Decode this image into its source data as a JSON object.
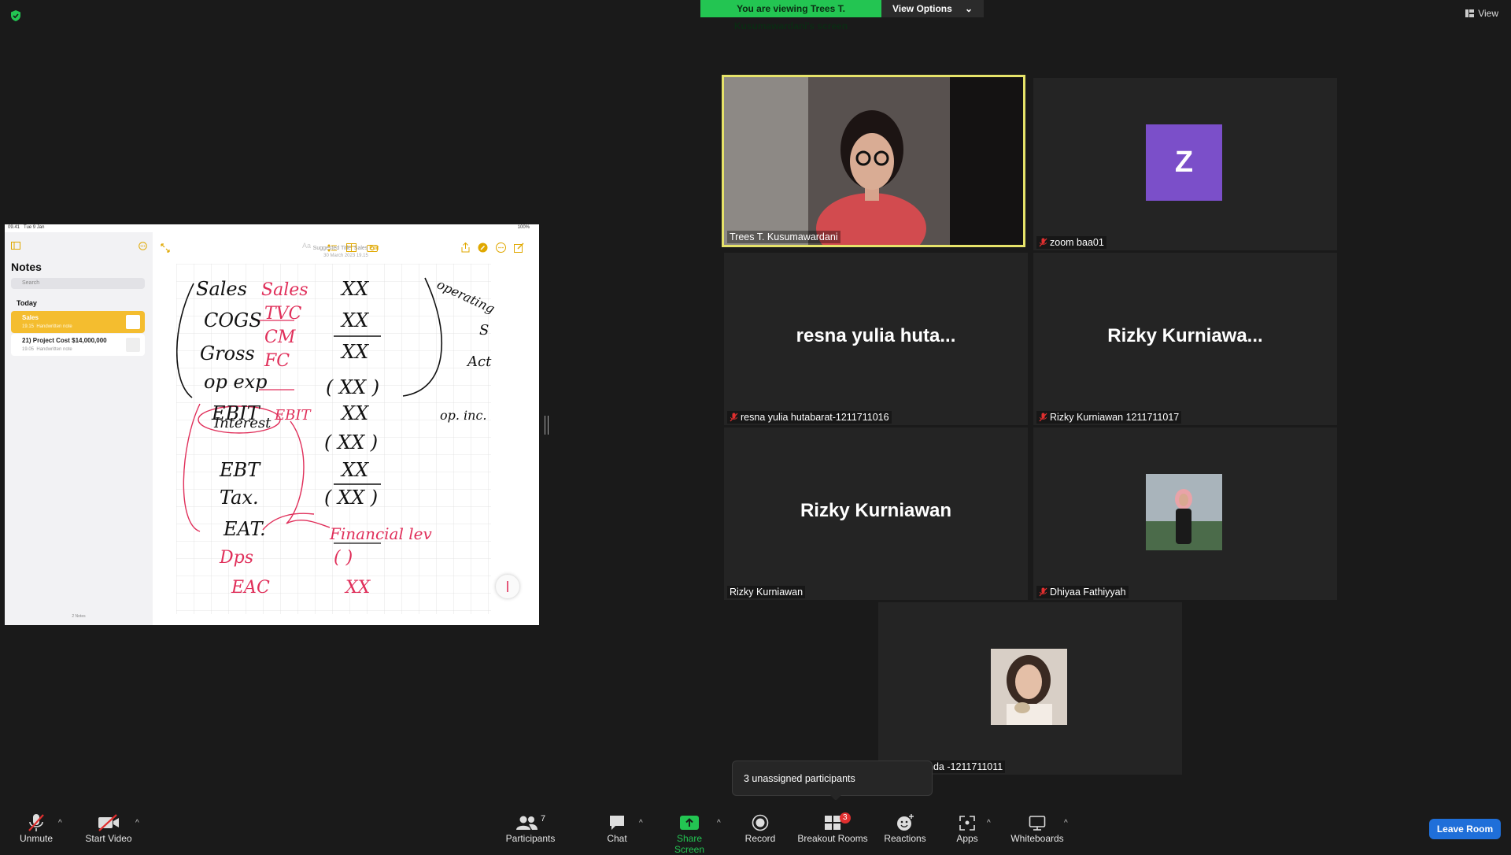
{
  "banner": {
    "viewing": "You are viewing Trees T. Kusumawardani's screen",
    "view_options": "View Options"
  },
  "view_button": "View",
  "shared_screen": {
    "status_time": "09.41",
    "status_date": "Tue 9 Jan",
    "status_battery": "100%",
    "sidebar_title": "Notes",
    "search_placeholder": "Search",
    "section": "Today",
    "notes": [
      {
        "title": "Sales",
        "time": "19.15",
        "sub": "Handwritten note"
      },
      {
        "title": "21) Project Cost $14,000,000",
        "time": "19.05",
        "sub": "Handwritten note"
      }
    ],
    "notes_count": "2 Notes",
    "suggested_title": "Suggested Title: Sales",
    "edit": "Edit",
    "date": "30 March 2023 19.15",
    "handwriting": {
      "black": [
        "Sales",
        "COGS",
        "Gross",
        "op exp",
        "EBIT",
        "Interest",
        "EBT",
        "Tax.",
        "EAT.",
        "XX",
        "XX",
        "XX",
        "( XX )",
        "XX",
        "( XX )",
        "XX",
        "( XX )",
        "operating",
        "S",
        "Act",
        "op. inc."
      ],
      "red": [
        "Sales",
        "TVC",
        "CM",
        "FC",
        "EBIT",
        "Financial lev",
        "Dps",
        "EAC",
        "( )",
        "XX"
      ]
    }
  },
  "tiles": [
    {
      "name": "Trees T. Kusumawardani",
      "muted": false
    },
    {
      "name": "zoom baa01",
      "avatar_letter": "Z",
      "muted": true
    },
    {
      "name": "resna yulia hutabarat-1211711016",
      "display": "resna yulia huta...",
      "muted": true
    },
    {
      "name": "Rizky Kurniawan 1211711017",
      "display": "Rizky Kurniawa...",
      "muted": true
    },
    {
      "name": "Rizky Kurniawan",
      "display": "Rizky Kurniawan",
      "muted": false
    },
    {
      "name": "Dhiyaa Fathiyyah",
      "muted": true
    },
    {
      "name": "nda -1211711011",
      "muted": false
    }
  ],
  "tooltip": "3 unassigned participants",
  "toolbar": {
    "unmute": "Unmute",
    "start_video": "Start Video",
    "participants": "Participants",
    "participants_count": "7",
    "chat": "Chat",
    "share_screen": "Share Screen",
    "record": "Record",
    "breakout_rooms": "Breakout Rooms",
    "breakout_badge": "3",
    "reactions": "Reactions",
    "apps": "Apps",
    "whiteboards": "Whiteboards",
    "leave": "Leave Room"
  },
  "colors": {
    "share_green": "#23c552",
    "active_speaker": "#e6e36a",
    "leave_blue": "#1f6fd9",
    "mute_red": "#e02f2f",
    "notes_accent": "#f4bd2f"
  }
}
